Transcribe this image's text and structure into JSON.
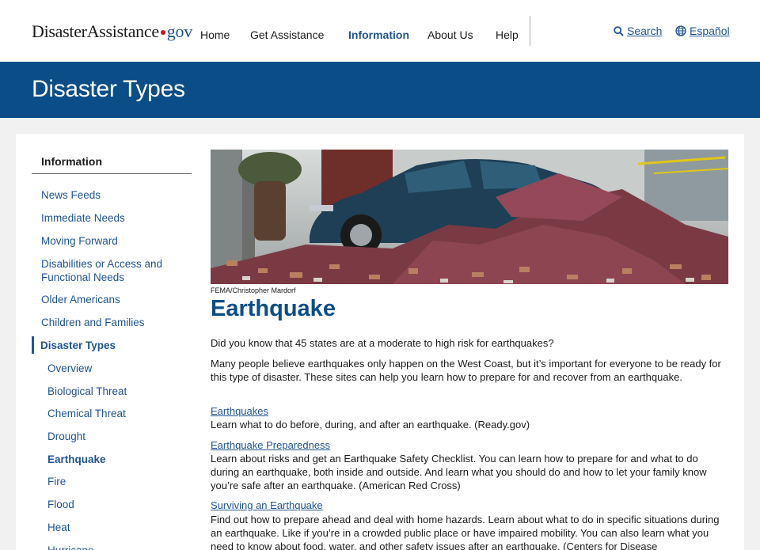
{
  "header": {
    "logo_main": "DisasterAssistance",
    "logo_tld": "gov",
    "nav": [
      {
        "label": "Home",
        "active": false
      },
      {
        "label": "Get Assistance",
        "active": false
      },
      {
        "label": "Information",
        "active": true
      },
      {
        "label": "About Us",
        "active": false
      },
      {
        "label": "Help",
        "active": false
      }
    ],
    "search_label": "Search",
    "language_label": "Español"
  },
  "banner": {
    "title": "Disaster Types"
  },
  "sidebar": {
    "title": "Information",
    "items": [
      "News Feeds",
      "Immediate Needs",
      "Moving Forward",
      "Disabilities or Access and Functional Needs",
      "Older Americans",
      "Children and Families",
      "Disaster Types"
    ],
    "subitems": [
      "Overview",
      "Biological Threat",
      "Chemical Threat",
      "Drought",
      "Earthquake",
      "Fire",
      "Flood",
      "Heat",
      "Hurricane"
    ]
  },
  "main": {
    "photo_credit": "FEMA/Christopher Mardorf",
    "title": "Earthquake",
    "intro_1": "Did you know that 45 states are at a moderate to high risk for earthquakes?",
    "intro_2": "Many people believe earthquakes only happen on the West Coast, but it’s important for everyone to be ready for this type of disaster. These sites can help you learn how to prepare for and recover from an earthquake.",
    "resources": [
      {
        "link": "Earthquakes",
        "desc": "Learn what to do before, during, and after an earthquake. (Ready.gov)"
      },
      {
        "link": "Earthquake Preparedness",
        "desc": "Learn about risks and get an Earthquake Safety Checklist. You can learn how to prepare for and what to do during an earthquake, both inside and outside. And learn what you should do and how to let your family know you’re safe after an earthquake. (American Red Cross)"
      },
      {
        "link": "Surviving an Earthquake",
        "desc": "Find out how to prepare ahead and deal with home hazards. Learn about what to do in specific situations during an earthquake. Like if you’re in a crowded public place or have impaired mobility. You can also learn what you need to know about food, water, and other safety issues after an earthquake. (Centers for Disease"
      }
    ]
  },
  "colors": {
    "brand_blue": "#0b4d87",
    "link_blue": "#205493",
    "logo_dot_red": "#c41230"
  }
}
